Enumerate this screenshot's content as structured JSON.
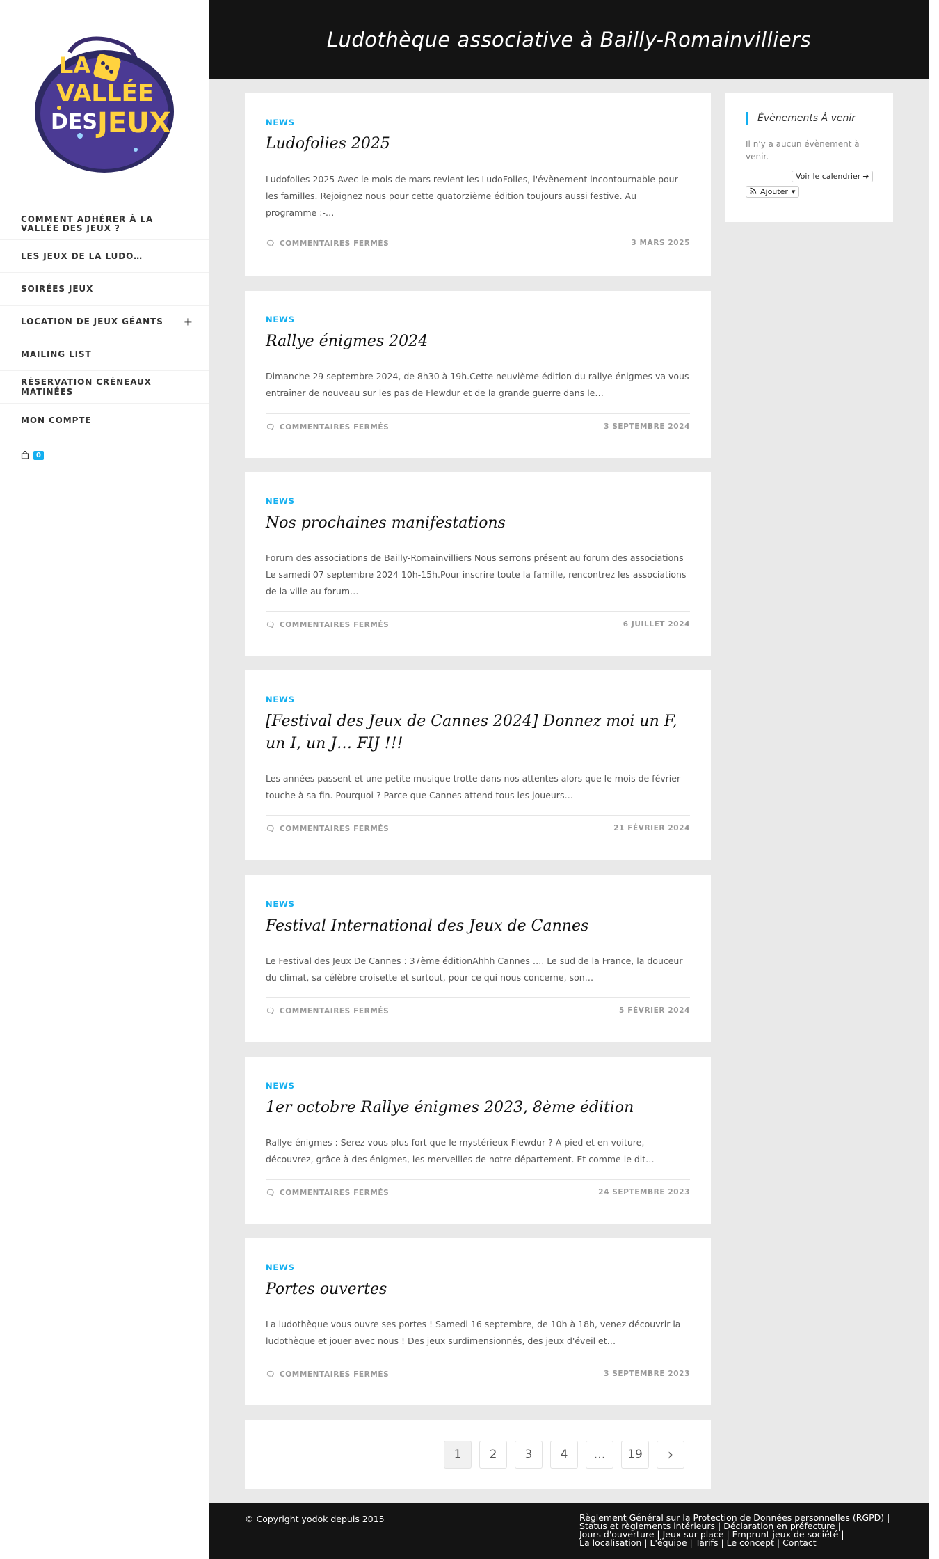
{
  "site": {
    "title": "Ludothèque associative à Bailly-Romainvilliers",
    "logo_text": [
      "LA",
      "VALLÉE",
      "DES",
      "JEUX"
    ]
  },
  "sidebar": {
    "items": [
      {
        "label": "COMMENT ADHÉRER À LA VALLÉE DES JEUX ?"
      },
      {
        "label": "LES JEUX DE LA LUDO…"
      },
      {
        "label": "SOIRÉES JEUX"
      },
      {
        "label": "LOCATION DE JEUX GÉANTS",
        "expand": "+"
      },
      {
        "label": "MAILING LIST"
      },
      {
        "label": "RÉSERVATION CRÉNEAUX MATINÉES"
      },
      {
        "label": "MON COMPTE"
      }
    ],
    "cart_count": "0"
  },
  "posts": [
    {
      "category": "NEWS",
      "title": "Ludofolies 2025",
      "excerpt": "Ludofolies 2025   Avec le mois de mars revient les LudoFolies, l'évènement incontournable pour les familles.   Rejoignez nous pour cette quatorzième édition toujours aussi festive.   Au programme :-…",
      "comments": "COMMENTAIRES FERMÉS",
      "date": "3 MARS 2025"
    },
    {
      "category": "NEWS",
      "title": "Rallye énigmes 2024",
      "excerpt": "Dimanche 29 septembre 2024, de 8h30 à 19h.Cette neuvième édition du rallye énigmes va vous entraîner de nouveau sur les pas de Flewdur et de la grande guerre dans le…",
      "comments": "COMMENTAIRES FERMÉS",
      "date": "3 SEPTEMBRE 2024"
    },
    {
      "category": "NEWS",
      "title": "Nos prochaines manifestations",
      "excerpt": "Forum des associations de Bailly-Romainvilliers Nous serrons présent au forum des associations Le samedi 07 septembre 2024 10h-15h.Pour inscrire toute la famille, rencontrez les associations de la ville au forum…",
      "comments": "COMMENTAIRES FERMÉS",
      "date": "6 JUILLET 2024"
    },
    {
      "category": "NEWS",
      "title": "[Festival des Jeux de Cannes 2024] Donnez moi un F, un I, un J… FIJ !!!",
      "excerpt": "Les années passent et une petite musique trotte dans nos attentes alors que le mois de février touche à sa fin. Pourquoi ? Parce que Cannes attend tous les joueurs…",
      "comments": "COMMENTAIRES FERMÉS",
      "date": "21 FÉVRIER 2024"
    },
    {
      "category": "NEWS",
      "title": "Festival International des Jeux de Cannes",
      "excerpt": "Le Festival des Jeux De Cannes : 37ème éditionAhhh Cannes …. Le sud de la France, la douceur du climat, sa célèbre croisette et surtout, pour ce qui nous concerne, son…",
      "comments": "COMMENTAIRES FERMÉS",
      "date": "5 FÉVRIER 2024"
    },
    {
      "category": "NEWS",
      "title": "1er octobre Rallye énigmes 2023, 8ème édition",
      "excerpt": "Rallye énigmes : Serez vous plus fort que le mystérieux Flewdur ? A pied et en voiture, découvrez, grâce à des énigmes, les merveilles de notre département. Et comme le dit…",
      "comments": "COMMENTAIRES FERMÉS",
      "date": "24 SEPTEMBRE 2023"
    },
    {
      "category": "NEWS",
      "title": "Portes ouvertes",
      "excerpt": "La ludothèque vous ouvre ses portes ! Samedi 16 septembre, de 10h à 18h, venez découvrir la ludothèque et jouer avec nous ! Des jeux surdimensionnés, des jeux d'éveil et…",
      "comments": "COMMENTAIRES FERMÉS",
      "date": "3 SEPTEMBRE 2023"
    }
  ],
  "widget": {
    "title": "Évènements À venir",
    "empty_text": "Il n'y a aucun évènement à venir.",
    "calendar_button": "Voir le calendrier",
    "add_button": "Ajouter"
  },
  "pagination": {
    "pages": [
      "1",
      "2",
      "3",
      "4",
      "…",
      "19"
    ],
    "current": "1",
    "next": "›"
  },
  "footer": {
    "copyright": "© Copyright yodok depuis 2015",
    "links": [
      "Règlement Général sur la Protection de Données personnelles (RGPD)",
      "Status et règlements intérieurs",
      "Déclaration en préfecture",
      "Jours d'ouverture",
      "Jeux sur place",
      "Emprunt jeux de société",
      "La localisation",
      "L'équipe",
      "Tarifs",
      "Le concept",
      "Contact"
    ]
  },
  "colors": {
    "accent": "#13aff0",
    "header_bg": "#141414",
    "page_bg": "#e9e9e9"
  }
}
